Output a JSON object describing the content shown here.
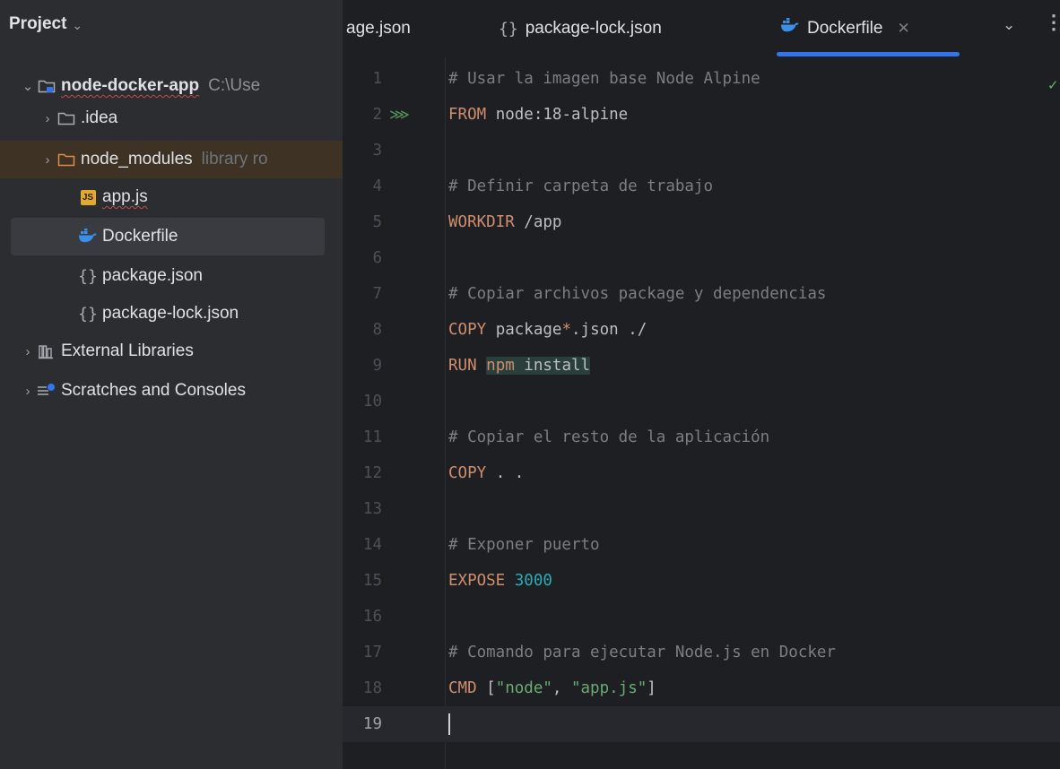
{
  "sidebar": {
    "title": "Project",
    "root": {
      "name": "node-docker-app",
      "path": "C:\\Use"
    },
    "items": [
      {
        "label": ".idea"
      },
      {
        "label": "node_modules",
        "note": "library ro"
      },
      {
        "label": "app.js"
      },
      {
        "label": "Dockerfile"
      },
      {
        "label": "package.json"
      },
      {
        "label": "package-lock.json"
      }
    ],
    "external_libraries": "External Libraries",
    "scratches": "Scratches and Consoles",
    "js_badge": "JS"
  },
  "tabs": [
    {
      "label": "age.json"
    },
    {
      "label": "package-lock.json"
    },
    {
      "label": "Dockerfile",
      "active": true
    }
  ],
  "editor": {
    "lines": [
      {
        "n": "1",
        "tokens": [
          {
            "t": "# Usar la imagen base Node Alpine",
            "c": "comment"
          }
        ]
      },
      {
        "n": "2",
        "tokens": [
          {
            "t": "FROM",
            "c": "kw"
          },
          {
            "t": " node:18-alpine",
            "c": ""
          }
        ]
      },
      {
        "n": "3",
        "tokens": []
      },
      {
        "n": "4",
        "tokens": [
          {
            "t": "# Definir carpeta de trabajo",
            "c": "comment"
          }
        ]
      },
      {
        "n": "5",
        "tokens": [
          {
            "t": "WORKDIR",
            "c": "kw"
          },
          {
            "t": " /app",
            "c": ""
          }
        ]
      },
      {
        "n": "6",
        "tokens": []
      },
      {
        "n": "7",
        "tokens": [
          {
            "t": "# Copiar archivos package y dependencias",
            "c": "comment"
          }
        ]
      },
      {
        "n": "8",
        "tokens": [
          {
            "t": "COPY",
            "c": "kw"
          },
          {
            "t": " package",
            "c": ""
          },
          {
            "t": "*",
            "c": "op"
          },
          {
            "t": ".json ./",
            "c": ""
          }
        ]
      },
      {
        "n": "9",
        "tokens": [
          {
            "t": "RUN",
            "c": "kw"
          },
          {
            "t": " ",
            "c": ""
          },
          {
            "t": "npm",
            "c": "kw hl"
          },
          {
            "t": " install",
            "c": "hl"
          }
        ]
      },
      {
        "n": "10",
        "tokens": []
      },
      {
        "n": "11",
        "tokens": [
          {
            "t": "# Copiar el resto de la aplicación",
            "c": "comment"
          }
        ]
      },
      {
        "n": "12",
        "tokens": [
          {
            "t": "COPY",
            "c": "kw"
          },
          {
            "t": " . .",
            "c": ""
          }
        ]
      },
      {
        "n": "13",
        "tokens": []
      },
      {
        "n": "14",
        "tokens": [
          {
            "t": "# Exponer puerto",
            "c": "comment"
          }
        ]
      },
      {
        "n": "15",
        "tokens": [
          {
            "t": "EXPOSE",
            "c": "kw"
          },
          {
            "t": " ",
            "c": ""
          },
          {
            "t": "3000",
            "c": "num"
          }
        ]
      },
      {
        "n": "16",
        "tokens": []
      },
      {
        "n": "17",
        "tokens": [
          {
            "t": "# Comando para ejecutar Node.js en Docker",
            "c": "comment"
          }
        ]
      },
      {
        "n": "18",
        "tokens": [
          {
            "t": "CMD",
            "c": "kw"
          },
          {
            "t": " [",
            "c": ""
          },
          {
            "t": "\"node\"",
            "c": "str"
          },
          {
            "t": ", ",
            "c": ""
          },
          {
            "t": "\"app.js\"",
            "c": "str"
          },
          {
            "t": "]",
            "c": ""
          }
        ]
      },
      {
        "n": "19",
        "tokens": [],
        "current": true
      }
    ]
  },
  "colors": {
    "accent": "#3574f0",
    "keyword": "#cf8e6d",
    "comment": "#7a7e85",
    "string": "#6aab73",
    "number": "#2aacb8"
  },
  "icons": [
    "chevron-down-icon",
    "chevron-right-icon",
    "folder-icon",
    "module-icon",
    "js-file-icon",
    "docker-icon",
    "json-icon",
    "library-icon",
    "scratches-icon",
    "run-icon",
    "check-icon",
    "more-vertical-icon",
    "close-icon"
  ]
}
